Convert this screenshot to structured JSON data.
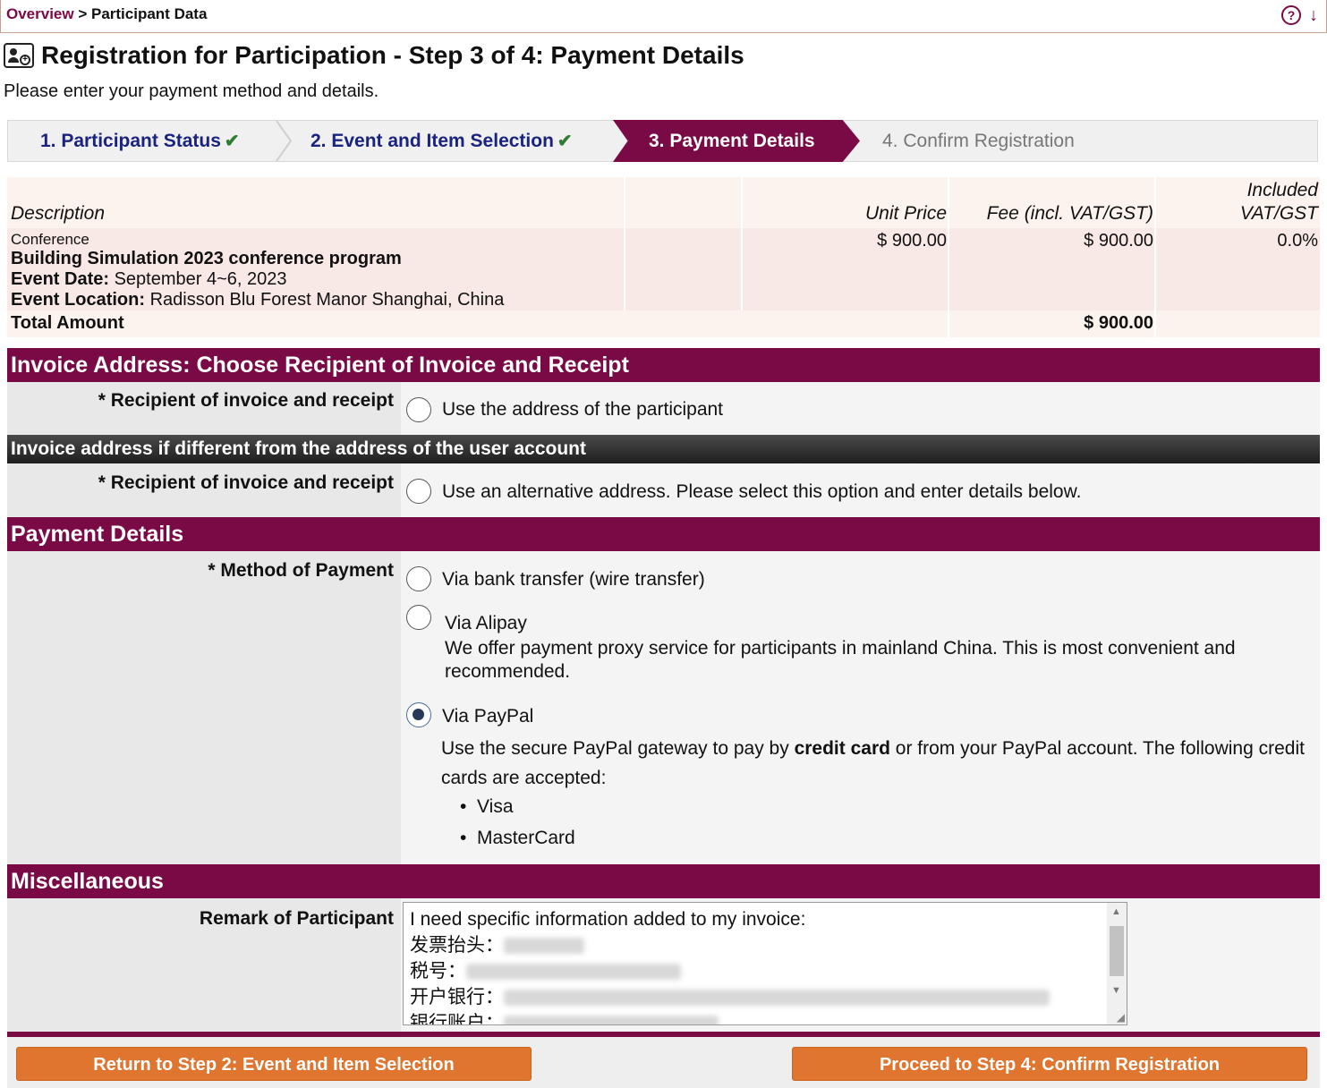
{
  "breadcrumb": {
    "link": "Overview",
    "separator": " > ",
    "current": "Participant Data"
  },
  "icons": {
    "help": "help-circle-icon",
    "download": "arrow-down-icon",
    "title": "registration-card-icon"
  },
  "page": {
    "title": "Registration for Participation - Step 3 of 4: Payment Details",
    "subtitle": "Please enter your payment method and details."
  },
  "steps": [
    {
      "label": "1. Participant Status",
      "done": "✔"
    },
    {
      "label": "2. Event and Item Selection",
      "done": "✔"
    },
    {
      "label": "3. Payment Details",
      "state": "active"
    },
    {
      "label": "4. Confirm Registration",
      "state": "pending"
    }
  ],
  "summary": {
    "headers": {
      "description": "Description",
      "unit_price": "Unit Price",
      "fee": "Fee (incl. VAT/GST)",
      "vat_line1": "Included",
      "vat_line2": "VAT/GST"
    },
    "item": {
      "category": "Conference",
      "name": "Building Simulation 2023 conference program",
      "date_label": "Event Date:",
      "date_value": "September 4~6, 2023",
      "location_label": "Event Location:",
      "location_value": "Radisson Blu Forest Manor Shanghai, China",
      "unit_price": "$ 900.00",
      "fee": "$ 900.00",
      "vat": "0.0%"
    },
    "total_label": "Total Amount",
    "total_value": "$ 900.00"
  },
  "invoice": {
    "heading": "Invoice Address: Choose Recipient of Invoice and Receipt",
    "recipient_label": "* Recipient of invoice and receipt",
    "option_participant": "Use the address of the participant",
    "alt_heading": "Invoice address if different from the address of the user account",
    "option_alternative": "Use an alternative address. Please select this option and enter details below."
  },
  "payment": {
    "heading": "Payment Details",
    "method_label": "* Method of Payment",
    "bank": "Via bank transfer (wire transfer)",
    "alipay": "Via Alipay",
    "alipay_desc": "We offer payment proxy service for participants in mainland China. This is most convenient and recommended.",
    "paypal": "Via PayPal",
    "paypal_desc_pre": "Use the secure PayPal gateway to pay by ",
    "paypal_desc_bold": "credit card",
    "paypal_desc_post": " or from your PayPal account. The following credit cards are accepted:",
    "cards": [
      "Visa",
      "MasterCard"
    ],
    "selected": "paypal"
  },
  "misc": {
    "heading": "Miscellaneous",
    "remark_label": "Remark of Participant",
    "remark_lines": [
      "I need specific information added to my invoice:",
      "发票抬头：",
      "税号：",
      "开户银行：",
      "银行账户："
    ]
  },
  "buttons": {
    "back": "Return to Step 2: Event and Item Selection",
    "next": "Proceed to Step 4: Confirm Registration"
  },
  "colors": {
    "brand": "#7a0a45",
    "button": "#e07530",
    "step_text": "#1a237e",
    "check": "#2e7d32"
  }
}
